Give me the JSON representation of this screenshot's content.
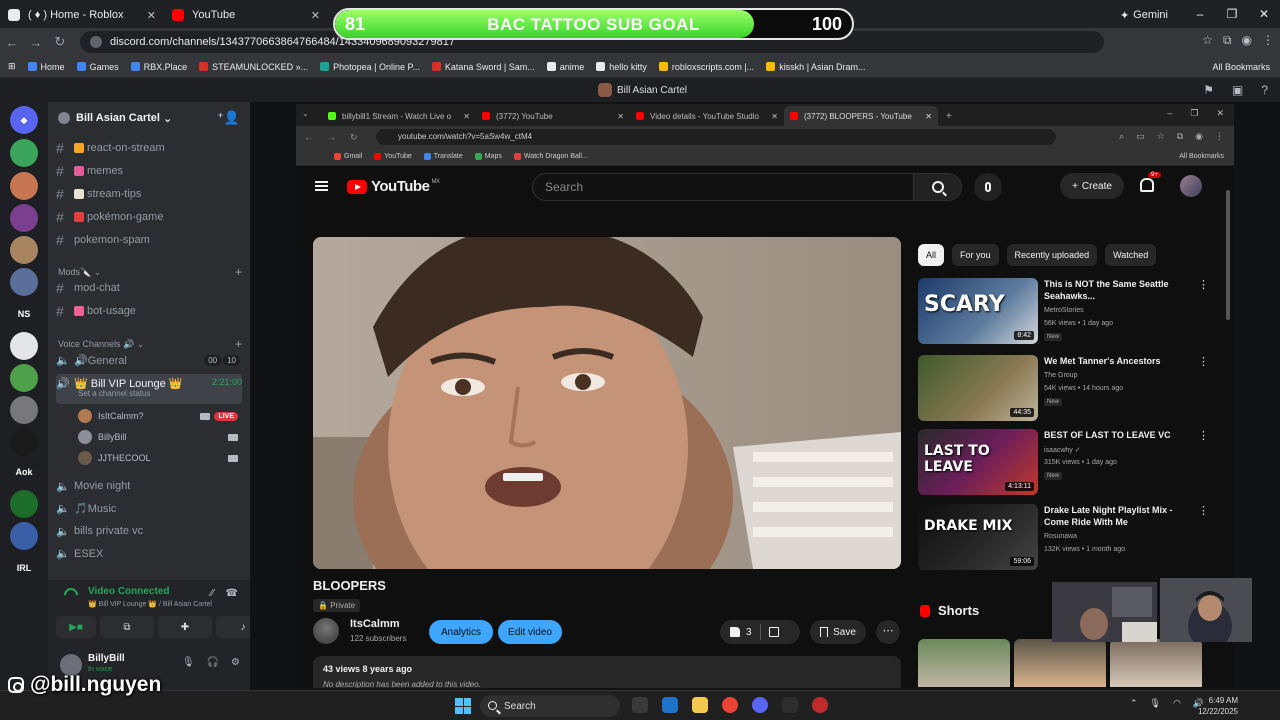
{
  "outer_browser": {
    "tabs": [
      {
        "label": "( ♦ ) Home - Roblox",
        "color": "#e8eaed"
      },
      {
        "label": "YouTube",
        "color": "#ff0000"
      }
    ],
    "gemini_label": "Gemini",
    "url": "discord.com/channels/1343770663864766484/1433409689093279817",
    "bookmarks": [
      {
        "label": "Home",
        "color": "#4285f4"
      },
      {
        "label": "Games",
        "color": "#4285f4"
      },
      {
        "label": "RBX.Place",
        "color": "#4285f4"
      },
      {
        "label": "STEAMUNLOCKED »...",
        "color": "#d93025"
      },
      {
        "label": "Photopea | Online P...",
        "color": "#18a497"
      },
      {
        "label": "Katana Sword | Sam...",
        "color": "#d93025"
      },
      {
        "label": "anime",
        "color": "#e8eaed"
      },
      {
        "label": "hello kitty",
        "color": "#e8eaed"
      },
      {
        "label": "robloxscripts.com |...",
        "color": "#fbbc04"
      },
      {
        "label": "kisskh | Asian Dram...",
        "color": "#fbbc04"
      }
    ],
    "all_bookmarks": "All Bookmarks"
  },
  "sub_goal": {
    "current": "81",
    "label": "BAC TATTOO SUB GOAL",
    "target": "100",
    "progress": 0.81
  },
  "discord": {
    "window_title": "Bill Asian Cartel",
    "server_name": "Bill Asian Cartel",
    "text_channels": [
      {
        "name": "react-on-stream",
        "emoji_color": "#f5a623"
      },
      {
        "name": "memes",
        "emoji_color": "#e05c9b"
      },
      {
        "name": "stream-tips",
        "emoji_color": "#e8e0d0"
      },
      {
        "name": "pokémon-game",
        "emoji_color": "#e04040"
      },
      {
        "name": "pokemon-spam",
        "emoji_color": ""
      }
    ],
    "mods_category": "Mods🔪",
    "mod_channels": [
      {
        "name": "mod-chat",
        "emoji_color": ""
      },
      {
        "name": "bot-usage",
        "emoji_color": "#f06090"
      }
    ],
    "voice_category": "Voice Channels 🔊",
    "general": {
      "name": "🔊General",
      "count_a": "00",
      "count_b": "10"
    },
    "vip": {
      "name": "👑 Bill VIP Lounge 👑",
      "timer": "2:21:00",
      "status": "Set a channel status"
    },
    "voice_users": [
      {
        "name": "IsItCalmm?",
        "live": "LIVE",
        "color": "#b07a52"
      },
      {
        "name": "BillyBill",
        "live": "",
        "color": "#8d8f98"
      },
      {
        "name": "JJTHECOOL",
        "live": "",
        "color": "#6a5a4a"
      }
    ],
    "other_voice": [
      "Movie night",
      "🎵Music",
      "bills private vc",
      "ESEX"
    ],
    "voice_panel": {
      "title": "Video Connected",
      "sub": "👑 Bill VIP Lounge 👑 / Bill Asian Cartel"
    },
    "user_panel": {
      "name": "BillyBill",
      "status": "In voice"
    }
  },
  "inner_browser": {
    "tabs": [
      {
        "label": "billybill1 Stream - Watch Live o",
        "color": "#53fc18"
      },
      {
        "label": "(3772) YouTube",
        "color": "#ff0000"
      },
      {
        "label": "Video details - YouTube Studio",
        "color": "#ff0000"
      },
      {
        "label": "(3772) BLOOPERS - YouTube",
        "color": "#ff0000"
      }
    ],
    "url": "youtube.com/watch?v=5aSw4w_ctM4",
    "bookmarks": [
      {
        "label": "Gmail",
        "color": "#ea4335"
      },
      {
        "label": "YouTube",
        "color": "#ff0000"
      },
      {
        "label": "Translate",
        "color": "#4285f4"
      },
      {
        "label": "Maps",
        "color": "#34a853"
      },
      {
        "label": "Watch Dragon Ball...",
        "color": "#e04040"
      }
    ],
    "all_bookmarks": "All Bookmarks"
  },
  "youtube": {
    "logo_text": "YouTube",
    "region": "MX",
    "search_placeholder": "Search",
    "create_label": "Create",
    "notif_count": "9+",
    "video_title": "BLOOPERS",
    "privacy": "Private",
    "channel": "ItsCalmm",
    "subscribers": "122 subscribers",
    "analytics_label": "Analytics",
    "edit_label": "Edit video",
    "likes": "3",
    "save_label": "Save",
    "views_line": "43 views  8 years ago",
    "description": "No description has been added to this video.",
    "chips": [
      "All",
      "For you",
      "Recently uploaded",
      "Watched"
    ],
    "recommendations": [
      {
        "title": "This is NOT the Same Seattle Seahawks...",
        "channel": "MetroStories",
        "meta": "56K views • 1 day ago",
        "badge": "New",
        "duration": "8:42",
        "thumb_text": "SCARY"
      },
      {
        "title": "We Met Tanner's Ancestors",
        "channel": "The Group",
        "meta": "54K views • 14 hours ago",
        "badge": "New",
        "duration": "44:35",
        "thumb_text": ""
      },
      {
        "title": "BEST OF LAST TO LEAVE VC",
        "channel": "isaacwhy ✓",
        "meta": "315K views • 1 day ago",
        "badge": "New",
        "duration": "4:13:11",
        "thumb_text": "LAST TO LEAVE"
      },
      {
        "title": "Drake Late Night Playlist Mix - Come Ride With Me",
        "channel": "Rosunawa",
        "meta": "132K views • 1 month ago",
        "badge": "",
        "duration": "59:06",
        "thumb_text": "DRAKE MIX"
      }
    ],
    "shorts_label": "Shorts"
  },
  "taskbar": {
    "search": "Search",
    "time": "6:49 AM",
    "date": "12/22/2025"
  },
  "overlay_handle": "@bill.nguyen"
}
